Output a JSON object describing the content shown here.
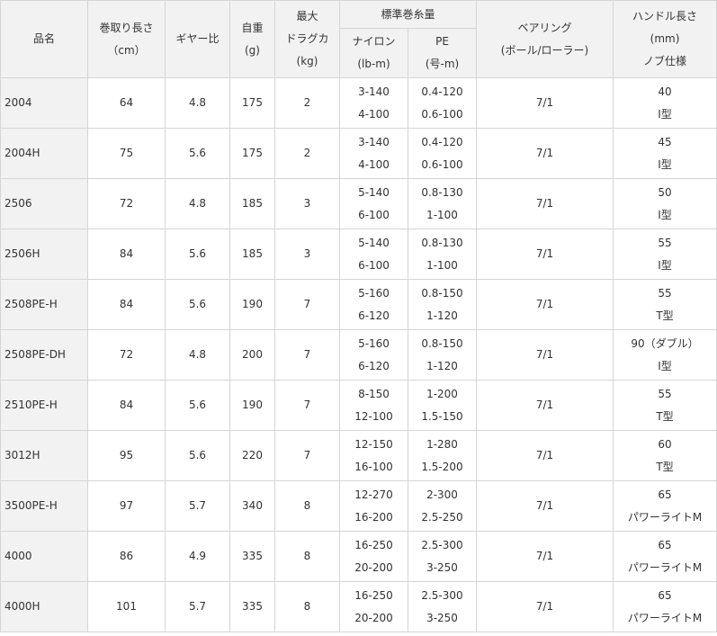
{
  "headers": {
    "name": "品名",
    "retrieve": [
      "巻取り長さ",
      "（cm）"
    ],
    "gear": "ギヤー比",
    "weight": [
      "自重",
      "(g)"
    ],
    "drag": [
      "最大",
      "ドラグカ",
      "(kg)"
    ],
    "capacity": "標準巻糸量",
    "nylon": [
      "ナイロン",
      "(lb-m)"
    ],
    "pe": [
      "PE",
      "(号-m)"
    ],
    "bearing": [
      "ベアリング",
      "(ボール/ローラー)"
    ],
    "handle": [
      "ハンドル長さ",
      "(mm)",
      "ノブ仕様"
    ]
  },
  "rows": [
    {
      "name": "2004",
      "retrieve": "64",
      "gear": "4.8",
      "weight": "175",
      "drag": "2",
      "nylon": [
        "3-140",
        "4-100"
      ],
      "pe": [
        "0.4-120",
        "0.6-100"
      ],
      "bearing": "7/1",
      "handle": [
        "40",
        "I型"
      ]
    },
    {
      "name": "2004H",
      "retrieve": "75",
      "gear": "5.6",
      "weight": "175",
      "drag": "2",
      "nylon": [
        "3-140",
        "4-100"
      ],
      "pe": [
        "0.4-120",
        "0.6-100"
      ],
      "bearing": "7/1",
      "handle": [
        "45",
        "I型"
      ]
    },
    {
      "name": "2506",
      "retrieve": "72",
      "gear": "4.8",
      "weight": "185",
      "drag": "3",
      "nylon": [
        "5-140",
        "6-100"
      ],
      "pe": [
        "0.8-130",
        "1-100"
      ],
      "bearing": "7/1",
      "handle": [
        "50",
        "I型"
      ]
    },
    {
      "name": "2506H",
      "retrieve": "84",
      "gear": "5.6",
      "weight": "185",
      "drag": "3",
      "nylon": [
        "5-140",
        "6-100"
      ],
      "pe": [
        "0.8-130",
        "1-100"
      ],
      "bearing": "7/1",
      "handle": [
        "55",
        "I型"
      ]
    },
    {
      "name": "2508PE-H",
      "retrieve": "84",
      "gear": "5.6",
      "weight": "190",
      "drag": "7",
      "nylon": [
        "5-160",
        "6-120"
      ],
      "pe": [
        "0.8-150",
        "1-120"
      ],
      "bearing": "7/1",
      "handle": [
        "55",
        "T型"
      ]
    },
    {
      "name": "2508PE-DH",
      "retrieve": "72",
      "gear": "4.8",
      "weight": "200",
      "drag": "7",
      "nylon": [
        "5-160",
        "6-120"
      ],
      "pe": [
        "0.8-150",
        "1-120"
      ],
      "bearing": "7/1",
      "handle": [
        "90（ダブル）",
        "I型"
      ]
    },
    {
      "name": "2510PE-H",
      "retrieve": "84",
      "gear": "5.6",
      "weight": "190",
      "drag": "7",
      "nylon": [
        "8-150",
        "12-100"
      ],
      "pe": [
        "1-200",
        "1.5-150"
      ],
      "bearing": "7/1",
      "handle": [
        "55",
        "T型"
      ]
    },
    {
      "name": "3012H",
      "retrieve": "95",
      "gear": "5.6",
      "weight": "220",
      "drag": "7",
      "nylon": [
        "12-150",
        "16-100"
      ],
      "pe": [
        "1-280",
        "1.5-200"
      ],
      "bearing": "7/1",
      "handle": [
        "60",
        "T型"
      ]
    },
    {
      "name": "3500PE-H",
      "retrieve": "97",
      "gear": "5.7",
      "weight": "340",
      "drag": "8",
      "nylon": [
        "12-270",
        "16-200"
      ],
      "pe": [
        "2-300",
        "2.5-250"
      ],
      "bearing": "7/1",
      "handle": [
        "65",
        "パワーライトM"
      ]
    },
    {
      "name": "4000",
      "retrieve": "86",
      "gear": "4.9",
      "weight": "335",
      "drag": "8",
      "nylon": [
        "16-250",
        "20-200"
      ],
      "pe": [
        "2.5-300",
        "3-250"
      ],
      "bearing": "7/1",
      "handle": [
        "65",
        "パワーライトM"
      ]
    },
    {
      "name": "4000H",
      "retrieve": "101",
      "gear": "5.7",
      "weight": "335",
      "drag": "8",
      "nylon": [
        "16-250",
        "20-200"
      ],
      "pe": [
        "2.5-300",
        "3-250"
      ],
      "bearing": "7/1",
      "handle": [
        "65",
        "パワーライトM"
      ]
    }
  ]
}
